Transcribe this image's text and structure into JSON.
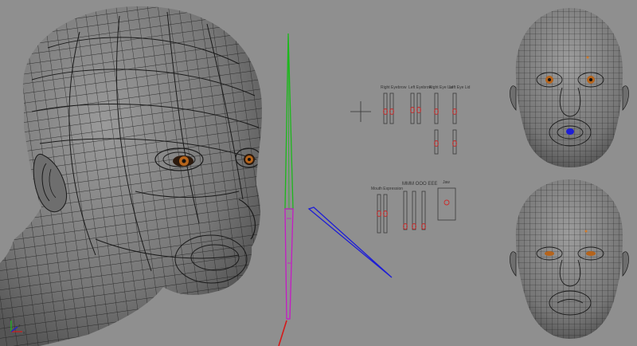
{
  "viewport": {
    "background": "#8f8f8f",
    "axis_labels": {
      "x": "x",
      "y": "y",
      "z": "z"
    }
  },
  "colors": {
    "wire": "#1f1f1f",
    "skin": "#7c7c7c",
    "skin_dark": "#5e5e5e",
    "panel_bg": "#8f8f8f",
    "gizmo_green": "#1cb81c",
    "gizmo_magenta": "#c51ac5",
    "gizmo_blue": "#1d1dd6",
    "gizmo_red": "#d41a1a",
    "iris": "#b5641c",
    "control": "#cc2a2a"
  },
  "controls": {
    "labels": {
      "right_eyebrow": "Right Eyebrow",
      "left_eyebrow": "Left Eyebrow",
      "right_eye_lid": "Right Eye Lid",
      "left_eye_lid": "Left Eye Lid",
      "mouth_expression": "Mouth Expression",
      "mouth_phonemes": "MMM OOO EEE",
      "jaw": "Jaw"
    }
  },
  "icons": {
    "axis_gizmo": "axis-triad-icon",
    "crosshair": "crosshair-icon"
  }
}
